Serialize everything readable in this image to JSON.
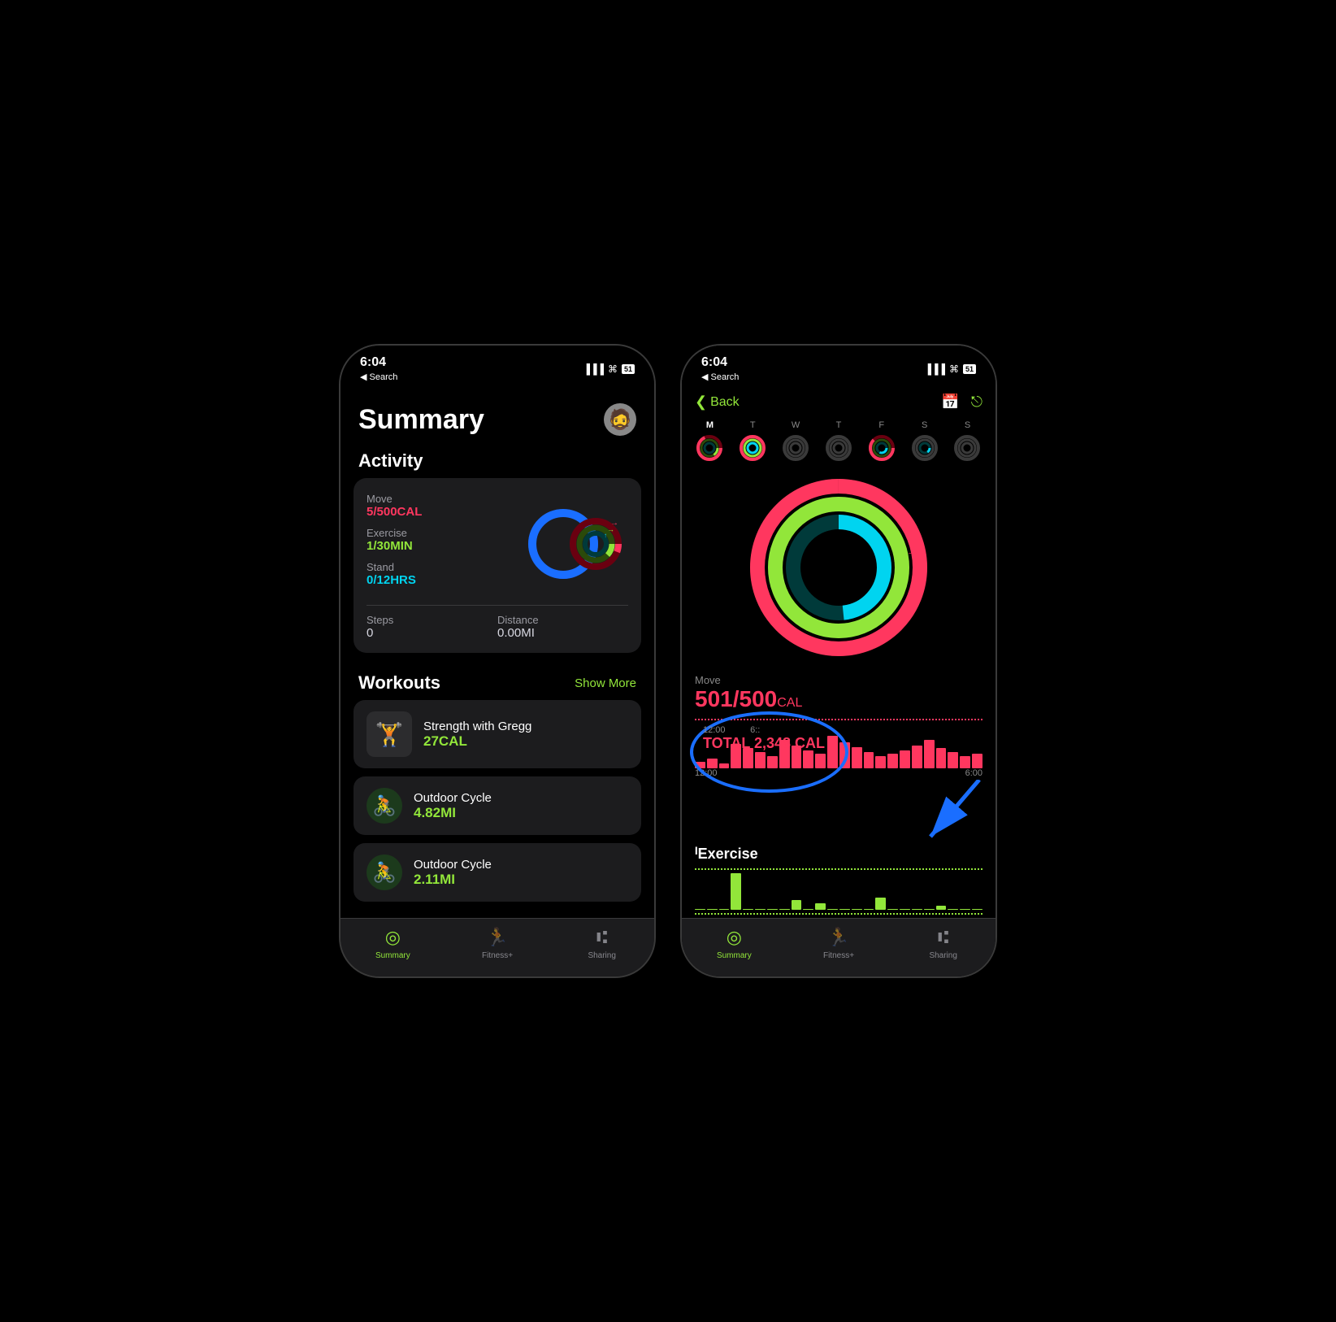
{
  "phones": {
    "left": {
      "status": {
        "time": "6:04",
        "search_back": "◀ Search",
        "signal": "▐▐▐",
        "wifi": "WiFi",
        "battery": "51"
      },
      "summary_title": "Summary",
      "activity_section": "Activity",
      "activity": {
        "move_label": "Move",
        "move_value": "5/500",
        "move_unit": "CAL",
        "exercise_label": "Exercise",
        "exercise_value": "1/30",
        "exercise_unit": "MIN",
        "stand_label": "Stand",
        "stand_value": "0/12",
        "stand_unit": "HRS",
        "steps_label": "Steps",
        "steps_value": "0",
        "distance_label": "Distance",
        "distance_value": "0.00MI"
      },
      "workouts_section": "Workouts",
      "show_more": "Show More",
      "workouts": [
        {
          "name": "Strength with Gregg",
          "value": "27CAL",
          "type": "image"
        },
        {
          "name": "Outdoor Cycle",
          "value": "4.82MI",
          "type": "icon"
        },
        {
          "name": "Outdoor Cycle",
          "value": "2.11MI",
          "type": "icon"
        }
      ],
      "tabs": [
        {
          "label": "Summary",
          "active": true
        },
        {
          "label": "Fitness+",
          "active": false
        },
        {
          "label": "Sharing",
          "active": false
        }
      ]
    },
    "right": {
      "status": {
        "time": "6:04",
        "search_back": "◀ Search",
        "signal": "▐▐▐",
        "wifi": "WiFi",
        "battery": "51"
      },
      "nav": {
        "back_label": "Back",
        "calendar_icon": "calendar",
        "share_icon": "share"
      },
      "week_days": [
        "M",
        "T",
        "W",
        "T",
        "F",
        "S",
        "S"
      ],
      "move_label": "Move",
      "move_value": "501/500",
      "move_unit": "CAL",
      "chart": {
        "times": [
          "12:00",
          "6:00"
        ],
        "total_time": "12:00              6::",
        "total_cal": "TOTAL 2,348 CAL"
      },
      "exercise_title": "Exercise",
      "bar_heights_move": [
        8,
        12,
        6,
        30,
        25,
        20,
        15,
        35,
        28,
        22,
        18,
        40,
        32,
        26,
        20,
        15,
        18,
        22,
        28,
        35,
        25,
        20,
        15,
        18
      ],
      "bar_heights_exercise": [
        0,
        0,
        0,
        45,
        0,
        0,
        0,
        0,
        12,
        0,
        8,
        0,
        0,
        0,
        0,
        15,
        0,
        0,
        0,
        0,
        5,
        0,
        0,
        0
      ],
      "tabs": [
        {
          "label": "Summary",
          "active": true
        },
        {
          "label": "Fitness+",
          "active": false
        },
        {
          "label": "Sharing",
          "active": false
        }
      ]
    }
  }
}
